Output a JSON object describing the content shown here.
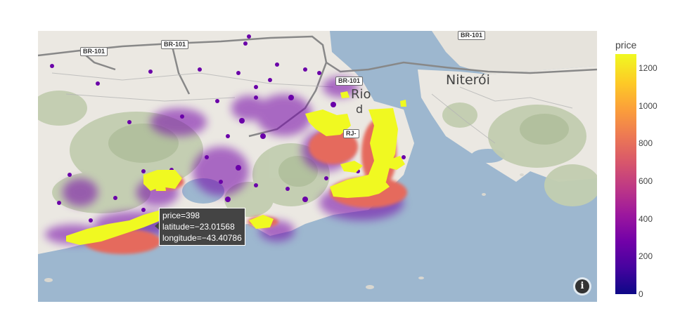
{
  "map": {
    "roads": [
      "BR-101",
      "BR-101",
      "BR-101",
      "BR-101",
      "RJ-"
    ],
    "places": [
      "Niterói",
      "Rio",
      "d"
    ]
  },
  "tooltip": {
    "line1": "price=398",
    "line2": "latitude=−23.01568",
    "line3": "longitude=−43.40786"
  },
  "colorbar": {
    "title": "price",
    "ticks": [
      "1200",
      "1000",
      "800",
      "600",
      "400",
      "200",
      "0"
    ],
    "range": [
      0,
      1280
    ],
    "colors": [
      "#0d0887",
      "#46039f",
      "#7201a8",
      "#9c179e",
      "#bd3786",
      "#d8576b",
      "#ed7953",
      "#fb9f3a",
      "#fdca26",
      "#f0f921"
    ]
  },
  "info_icon": "info-icon"
}
